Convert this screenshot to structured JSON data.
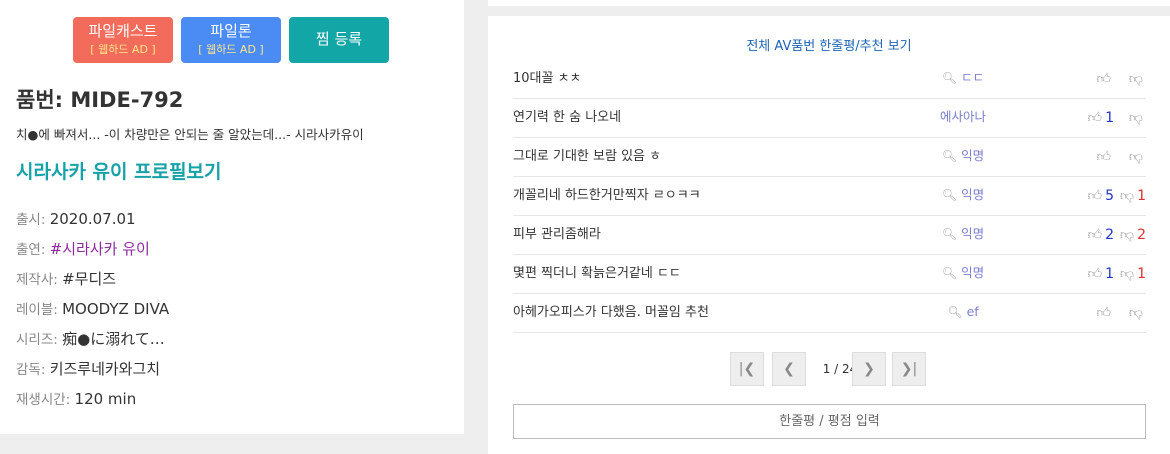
{
  "buttons": {
    "pileecast": {
      "label": "파일캐스트",
      "sub": "[ 웹하드 AD ]"
    },
    "pileeron": {
      "label": "파일론",
      "sub": "[ 웹하드 AD ]"
    },
    "jjim": {
      "label": "찜 등록"
    }
  },
  "product": {
    "title": "품번: MIDE-792",
    "subtitle": "치●에 빠져서... -이 차량만은 안되는 줄 알았는데...- 시라사카유이",
    "profile_link": "시라사카 유이 프로필보기"
  },
  "info": [
    {
      "label": "출시: ",
      "value": "2020.07.01"
    },
    {
      "label": "출연: ",
      "value": "#시라사카 유이"
    },
    {
      "label": "제작사: ",
      "value": "#무디즈"
    },
    {
      "label": "레이블: ",
      "value": "MOODYZ DIVA"
    },
    {
      "label": "시리즈: ",
      "value": "痴●に溺れて…"
    },
    {
      "label": "감독: ",
      "value": "키즈루네카와그치"
    },
    {
      "label": "재생시간: ",
      "value": "120 min"
    }
  ],
  "reviews_header": "전체 AV품번 한줄평/추천 보기",
  "reviews": [
    {
      "text": "10대꼴 ㅊㅊ",
      "author": "ㄷㄷ",
      "up": "",
      "down": ""
    },
    {
      "text": "연기력 한 숨 나오네",
      "author": "에사아나",
      "up": "1",
      "down": ""
    },
    {
      "text": "그대로 기대한 보람 있음 ㅎ",
      "author": "익명",
      "up": "",
      "down": ""
    },
    {
      "text": "개꼴리네 하드한거만찍자 ㄹㅇㅋㅋ",
      "author": "익명",
      "up": "5",
      "down": "1"
    },
    {
      "text": "피부 관리좀해라",
      "author": "익명",
      "up": "2",
      "down": "2"
    },
    {
      "text": "몇편 찍더니 확늙은거같네 ㄷㄷ",
      "author": "익명",
      "up": "1",
      "down": "1"
    },
    {
      "text": "아헤가오피스가 다했음. 머꼴임 추천",
      "author": "ef",
      "up": "",
      "down": ""
    }
  ],
  "pagination": {
    "info": "1 / 24",
    "first": "|❮",
    "prev": "❮",
    "next": "❯",
    "last": "❯|"
  },
  "input_button": "한줄평 / 평점 입력",
  "icons": {
    "search": "search-icon",
    "thumb_up": "thumb-up-icon",
    "thumb_down": "thumb-down-icon"
  },
  "colors": {
    "pileecast": "#f26b5b",
    "pileeron": "#4b8bf4",
    "jjim": "#13a6a6",
    "teal_link": "#17a2a8",
    "actress_link": "#8e2b9e",
    "up_count": "#2233cc",
    "down_count": "#e03030"
  }
}
